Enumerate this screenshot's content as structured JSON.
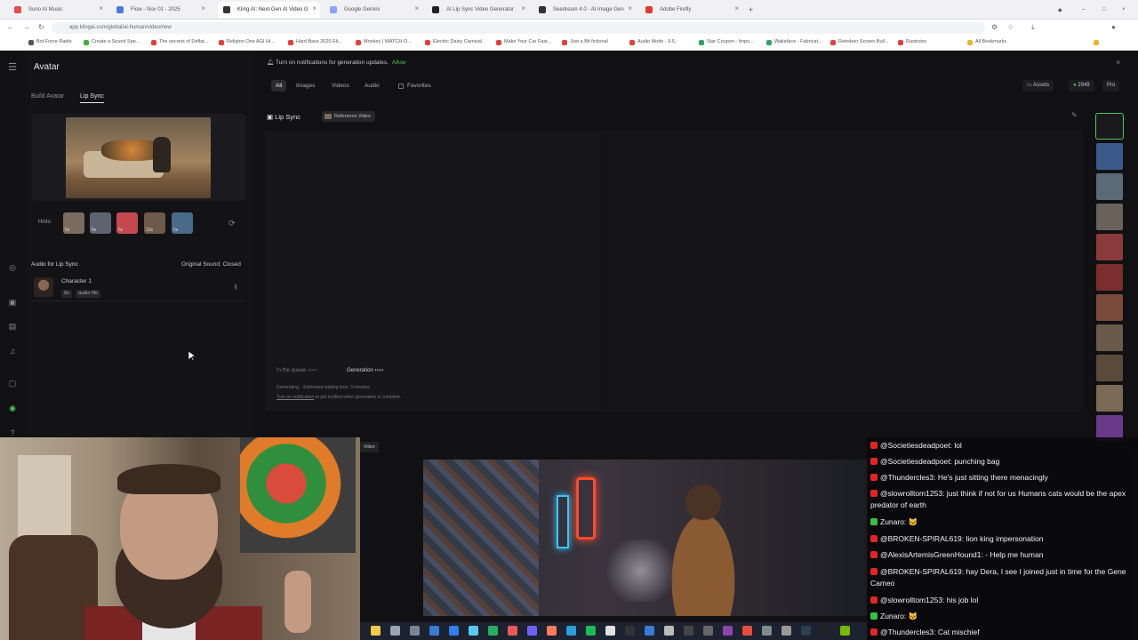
{
  "browser": {
    "tabs": [
      {
        "label": "Suno AI Music",
        "color": "#e84b4b"
      },
      {
        "label": "Flow - Nov 01 - 2025",
        "color": "#4a7be0"
      },
      {
        "label": "Kling AI: Next-Gen AI Video G",
        "color": "#333333"
      },
      {
        "label": "Google Gemini",
        "color": "#8aa4f4"
      },
      {
        "label": "AI Lip Sync Video Generator",
        "color": "#222222"
      },
      {
        "label": "Seedream 4.0 - AI Image Gen",
        "color": "#333333"
      },
      {
        "label": "Adobe Firefly",
        "color": "#e8352c"
      }
    ],
    "url": "app.klingai.com/global/ai-human/video/new",
    "bookmarks": [
      "Bot Force Radio",
      "Create a Sound Spe...",
      "The secrets of Deflat...",
      "Religion One AGI Hi...",
      "Hard Bass 2025 Eli...",
      "Monkey | WATCH O...",
      "Electric Daisy Carnival",
      "Make Your Car Fast...",
      "Just a Bit fictional",
      "Audio Mode - 9.5.",
      "Star Coupon - Impo...",
      "Wakeface - Fabricat...",
      "Reindeer Screen Buil...",
      "Rastrotec",
      "All Bookmarks"
    ]
  },
  "sidebar": {
    "title": "Avatar",
    "tabs": [
      "Build Avatar",
      "Lip Sync"
    ],
    "hints_label": "Hints:",
    "hints": [
      {
        "duration": "5s",
        "color": "#7a6a60"
      },
      {
        "duration": "8s",
        "color": "#5d6470"
      },
      {
        "duration": "5s",
        "color": "#c5484f"
      },
      {
        "duration": "10s",
        "color": "#6e5a4a"
      },
      {
        "duration": "5s",
        "color": "#4a6a8a"
      }
    ],
    "audio_label": "Audio for Lip Sync",
    "original_sound": "Original Sound: Closed",
    "character": {
      "name": "Character 1",
      "duration": "8s",
      "type": "audio file"
    }
  },
  "main": {
    "notification": "Turn on notifications for generation updates.",
    "allow": "Allow",
    "filters": [
      "All",
      "Images",
      "Videos",
      "Audio",
      "Favorites"
    ],
    "assets": "Assets",
    "credits": "2949",
    "pro": "Pro",
    "gen_title": "Lip Sync",
    "reference_video": "Reference Video",
    "queue": "In the queue",
    "generation": "Generation",
    "status_line1": "Generating... Estimated waiting time: 3 minutes",
    "status_link": "Turn on notification",
    "status_line2": "to get notified when generation is complete."
  },
  "overlay": {
    "video_label": "Video",
    "chat": [
      {
        "badge": "red",
        "user": "@Societiesdeadpoet:",
        "text": "lol"
      },
      {
        "badge": "red",
        "user": "@Societiesdeadpoet:",
        "text": "punching bag"
      },
      {
        "badge": "red",
        "user": "@Thundercles3:",
        "text": "He's just sitting there menacingly"
      },
      {
        "badge": "red",
        "user": "@slowrolltom1253:",
        "text": "just think if not for us Humans cats would be the apex predator of earth"
      },
      {
        "badge": "green",
        "user": "Zunaro:",
        "text": "🐱"
      },
      {
        "badge": "red",
        "user": "@BROKEN-SPIRAL619:",
        "text": "lion king impersonation"
      },
      {
        "badge": "red",
        "user": "@AlexisArtemisGreenHound1:",
        "text": "- Help me human"
      },
      {
        "badge": "red",
        "user": "@BROKEN-SPIRAL619:",
        "text": "hay Dera, I see I joined just in time for the Gene Cameo"
      },
      {
        "badge": "red",
        "user": "@slowrolltom1253:",
        "text": "his job lol"
      },
      {
        "badge": "green",
        "user": "Zunaro:",
        "text": "🐱"
      },
      {
        "badge": "red",
        "user": "@Thundercles3:",
        "text": "Cat mischief"
      }
    ]
  },
  "icons": {
    "menu": "menu-icon",
    "bell": "bell-icon",
    "close": "close-icon",
    "refresh": "refresh-icon",
    "adjust": "adjust-icon",
    "edit": "edit-icon"
  }
}
